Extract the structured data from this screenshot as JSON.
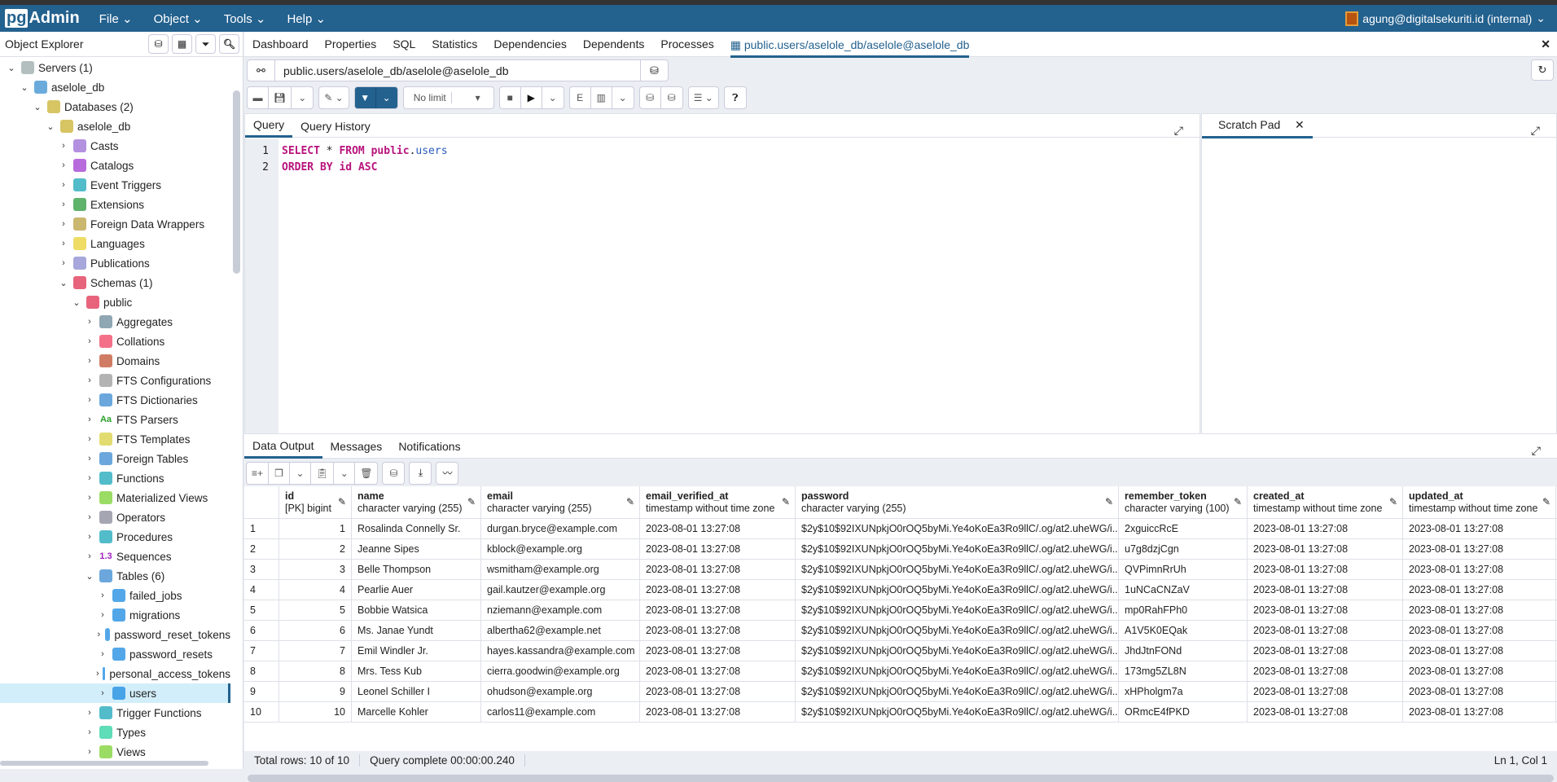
{
  "app": {
    "logo": "pgAdmin",
    "logo_pg": "pg",
    "logo_rest": "Admin",
    "menu": [
      "File",
      "Object",
      "Tools",
      "Help"
    ],
    "user": "agung@digitalsekuriti.id (internal)"
  },
  "sidebar": {
    "title": "Object Explorer",
    "tree": [
      {
        "label": "Servers (1)",
        "level": 0,
        "open": true,
        "icon": "servers-icon",
        "color": "#9aa"
      },
      {
        "label": "aselole_db",
        "level": 1,
        "open": true,
        "icon": "server-icon",
        "color": "#3a8fd0"
      },
      {
        "label": "Databases (2)",
        "level": 2,
        "open": true,
        "icon": "databases-icon",
        "color": "#c9b230"
      },
      {
        "label": "aselole_db",
        "level": 3,
        "open": true,
        "icon": "database-icon",
        "color": "#c9b230"
      },
      {
        "label": "Casts",
        "level": 4,
        "icon": "casts-icon",
        "color": "#9a6cd6"
      },
      {
        "label": "Catalogs",
        "level": 4,
        "icon": "catalogs-icon",
        "color": "#a03ad0"
      },
      {
        "label": "Event Triggers",
        "level": 4,
        "icon": "event-triggers-icon",
        "color": "#1aa6b8"
      },
      {
        "label": "Extensions",
        "level": 4,
        "icon": "extensions-icon",
        "color": "#2a9a3a"
      },
      {
        "label": "Foreign Data Wrappers",
        "level": 4,
        "icon": "foreign-data-wrappers-icon",
        "color": "#b8a040"
      },
      {
        "label": "Languages",
        "level": 4,
        "icon": "languages-icon",
        "color": "#e8d030"
      },
      {
        "label": "Publications",
        "level": 4,
        "icon": "publications-icon",
        "color": "#8a8ad0"
      },
      {
        "label": "Schemas (1)",
        "level": 4,
        "open": true,
        "icon": "schemas-icon",
        "color": "#e03050"
      },
      {
        "label": "public",
        "level": 5,
        "open": true,
        "icon": "schema-icon",
        "color": "#e03050"
      },
      {
        "label": "Aggregates",
        "level": 6,
        "icon": "aggregates-icon",
        "color": "#6a8a9a"
      },
      {
        "label": "Collations",
        "level": 6,
        "icon": "collations-icon",
        "color": "#f04060"
      },
      {
        "label": "Domains",
        "level": 6,
        "icon": "domains-icon",
        "color": "#c05030"
      },
      {
        "label": "FTS Configurations",
        "level": 6,
        "icon": "fts-configurations-icon",
        "color": "#999"
      },
      {
        "label": "FTS Dictionaries",
        "level": 6,
        "icon": "fts-dictionaries-icon",
        "color": "#3a8ad0"
      },
      {
        "label": "FTS Parsers",
        "level": 6,
        "icon": "fts-parsers-icon",
        "color": "#2aa02a",
        "glyph": "Aa"
      },
      {
        "label": "FTS Templates",
        "level": 6,
        "icon": "fts-templates-icon",
        "color": "#d8d040"
      },
      {
        "label": "Foreign Tables",
        "level": 6,
        "icon": "foreign-tables-icon",
        "color": "#3a8ad0"
      },
      {
        "label": "Functions",
        "level": 6,
        "icon": "functions-icon",
        "color": "#1aa6b8"
      },
      {
        "label": "Materialized Views",
        "level": 6,
        "icon": "materialized-views-icon",
        "color": "#7ad030"
      },
      {
        "label": "Operators",
        "level": 6,
        "icon": "operators-icon",
        "color": "#889"
      },
      {
        "label": "Procedures",
        "level": 6,
        "icon": "procedures-icon",
        "color": "#1aa6b8"
      },
      {
        "label": "Sequences",
        "level": 6,
        "icon": "sequences-icon",
        "color": "#a020c0",
        "glyph": "1.3"
      },
      {
        "label": "Tables (6)",
        "level": 6,
        "open": true,
        "icon": "tables-icon",
        "color": "#3a8ad0"
      },
      {
        "label": "failed_jobs",
        "level": 7,
        "icon": "table-icon",
        "color": "#1a8ae0"
      },
      {
        "label": "migrations",
        "level": 7,
        "icon": "table-icon",
        "color": "#1a8ae0"
      },
      {
        "label": "password_reset_tokens",
        "level": 7,
        "icon": "table-icon",
        "color": "#1a8ae0"
      },
      {
        "label": "password_resets",
        "level": 7,
        "icon": "table-icon",
        "color": "#1a8ae0"
      },
      {
        "label": "personal_access_tokens",
        "level": 7,
        "icon": "table-icon",
        "color": "#1a8ae0"
      },
      {
        "label": "users",
        "level": 7,
        "icon": "table-icon",
        "color": "#1a8ae0",
        "selected": true
      },
      {
        "label": "Trigger Functions",
        "level": 6,
        "icon": "trigger-functions-icon",
        "color": "#1aa6b8"
      },
      {
        "label": "Types",
        "level": 6,
        "icon": "types-icon",
        "color": "#2ad0a0"
      },
      {
        "label": "Views",
        "level": 6,
        "icon": "views-icon",
        "color": "#7ad030"
      }
    ]
  },
  "tabs": [
    "Dashboard",
    "Properties",
    "SQL",
    "Statistics",
    "Dependencies",
    "Dependents",
    "Processes"
  ],
  "active_tab": "public.users/aselole_db/aselole@aselole_db",
  "connection": "public.users/aselole_db/aselole@aselole_db",
  "toolbar": {
    "limit": "No limit"
  },
  "query": {
    "tabs": [
      "Query",
      "Query History"
    ],
    "lines": [
      "1",
      "2"
    ]
  },
  "scratch": {
    "title": "Scratch Pad"
  },
  "output": {
    "tabs": [
      "Data Output",
      "Messages",
      "Notifications"
    ],
    "columns": [
      {
        "name": "id",
        "type": "[PK] bigint"
      },
      {
        "name": "name",
        "type": "character varying (255)"
      },
      {
        "name": "email",
        "type": "character varying (255)"
      },
      {
        "name": "email_verified_at",
        "type": "timestamp without time zone"
      },
      {
        "name": "password",
        "type": "character varying (255)"
      },
      {
        "name": "remember_token",
        "type": "character varying (100)"
      },
      {
        "name": "created_at",
        "type": "timestamp without time zone"
      },
      {
        "name": "updated_at",
        "type": "timestamp without time zone"
      }
    ],
    "rows": [
      [
        "1",
        "1",
        "Rosalinda Connelly Sr.",
        "durgan.bryce@example.com",
        "2023-08-01 13:27:08",
        "$2y$10$92IXUNpkjO0rOQ5byMi.Ye4oKoEa3Ro9llC/.og/at2.uheWG/i...",
        "2xguiccRcE",
        "2023-08-01 13:27:08",
        "2023-08-01 13:27:08"
      ],
      [
        "2",
        "2",
        "Jeanne Sipes",
        "kblock@example.org",
        "2023-08-01 13:27:08",
        "$2y$10$92IXUNpkjO0rOQ5byMi.Ye4oKoEa3Ro9llC/.og/at2.uheWG/i...",
        "u7g8dzjCgn",
        "2023-08-01 13:27:08",
        "2023-08-01 13:27:08"
      ],
      [
        "3",
        "3",
        "Belle Thompson",
        "wsmitham@example.org",
        "2023-08-01 13:27:08",
        "$2y$10$92IXUNpkjO0rOQ5byMi.Ye4oKoEa3Ro9llC/.og/at2.uheWG/i...",
        "QVPimnRrUh",
        "2023-08-01 13:27:08",
        "2023-08-01 13:27:08"
      ],
      [
        "4",
        "4",
        "Pearlie Auer",
        "gail.kautzer@example.org",
        "2023-08-01 13:27:08",
        "$2y$10$92IXUNpkjO0rOQ5byMi.Ye4oKoEa3Ro9llC/.og/at2.uheWG/i...",
        "1uNCaCNZaV",
        "2023-08-01 13:27:08",
        "2023-08-01 13:27:08"
      ],
      [
        "5",
        "5",
        "Bobbie Watsica",
        "nziemann@example.com",
        "2023-08-01 13:27:08",
        "$2y$10$92IXUNpkjO0rOQ5byMi.Ye4oKoEa3Ro9llC/.og/at2.uheWG/i...",
        "mp0RahFPh0",
        "2023-08-01 13:27:08",
        "2023-08-01 13:27:08"
      ],
      [
        "6",
        "6",
        "Ms. Janae Yundt",
        "albertha62@example.net",
        "2023-08-01 13:27:08",
        "$2y$10$92IXUNpkjO0rOQ5byMi.Ye4oKoEa3Ro9llC/.og/at2.uheWG/i...",
        "A1V5K0EQak",
        "2023-08-01 13:27:08",
        "2023-08-01 13:27:08"
      ],
      [
        "7",
        "7",
        "Emil Windler Jr.",
        "hayes.kassandra@example.com",
        "2023-08-01 13:27:08",
        "$2y$10$92IXUNpkjO0rOQ5byMi.Ye4oKoEa3Ro9llC/.og/at2.uheWG/i...",
        "JhdJtnFONd",
        "2023-08-01 13:27:08",
        "2023-08-01 13:27:08"
      ],
      [
        "8",
        "8",
        "Mrs. Tess Kub",
        "cierra.goodwin@example.org",
        "2023-08-01 13:27:08",
        "$2y$10$92IXUNpkjO0rOQ5byMi.Ye4oKoEa3Ro9llC/.og/at2.uheWG/i...",
        "173mg5ZL8N",
        "2023-08-01 13:27:08",
        "2023-08-01 13:27:08"
      ],
      [
        "9",
        "9",
        "Leonel Schiller I",
        "ohudson@example.org",
        "2023-08-01 13:27:08",
        "$2y$10$92IXUNpkjO0rOQ5byMi.Ye4oKoEa3Ro9llC/.og/at2.uheWG/i...",
        "xHPholgm7a",
        "2023-08-01 13:27:08",
        "2023-08-01 13:27:08"
      ],
      [
        "10",
        "10",
        "Marcelle Kohler",
        "carlos11@example.com",
        "2023-08-01 13:27:08",
        "$2y$10$92IXUNpkjO0rOQ5byMi.Ye4oKoEa3Ro9llC/.og/at2.uheWG/i...",
        "ORmcE4fPKD",
        "2023-08-01 13:27:08",
        "2023-08-01 13:27:08"
      ]
    ]
  },
  "status": {
    "rows": "Total rows: 10 of 10",
    "query": "Query complete 00:00:00.240",
    "cursor": "Ln 1, Col 1"
  },
  "colors": {
    "brand": "#23618e",
    "keyword": "#b8137c",
    "identifier": "#2a5bbf",
    "selected_row": "#d2eefa"
  }
}
